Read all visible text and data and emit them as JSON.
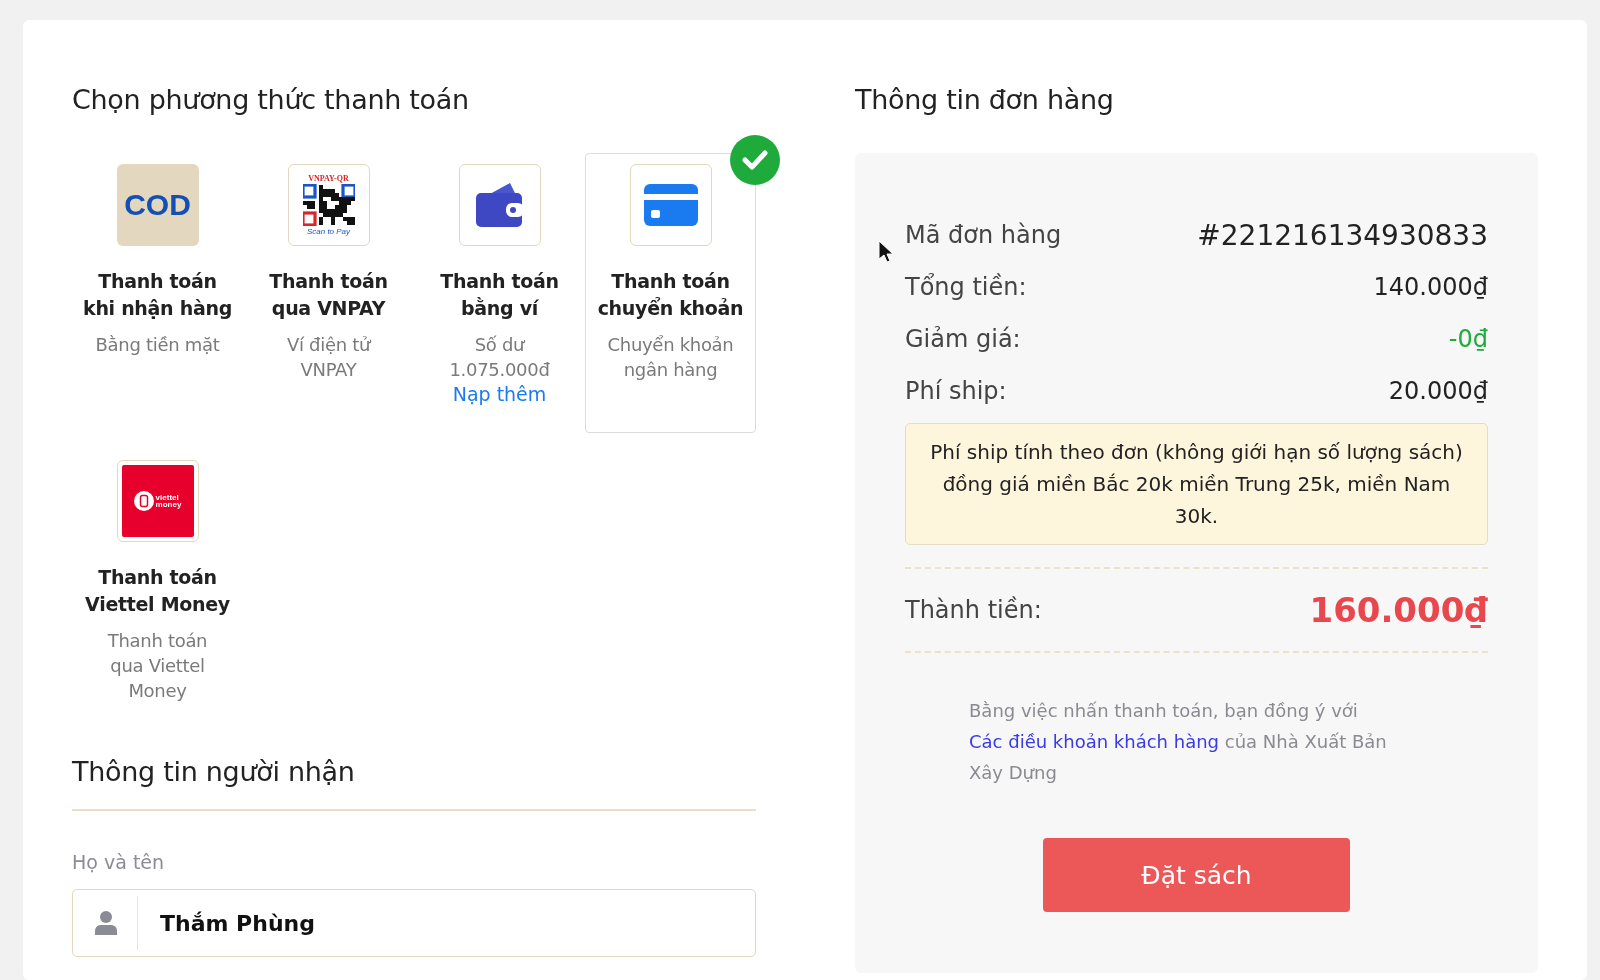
{
  "payment": {
    "title": "Chọn phương thức thanh toán",
    "methods": [
      {
        "kind": "cod",
        "logo": [
          "COD"
        ],
        "title": "Thanh toán\nkhi nhận hàng",
        "description": "Bằng tiền mặt",
        "selected": false
      },
      {
        "kind": "qr",
        "logo": [
          "VNPAY-QR",
          "Scan to Pay"
        ],
        "title": "Thanh toán\nqua VNPAY",
        "description": "Ví điện tử\nVNPAY",
        "selected": false
      },
      {
        "kind": "wallet",
        "title": "Thanh toán\nbằng ví",
        "description": "Số dư\n1.075.000đ",
        "link": "Nạp thêm",
        "selected": false
      },
      {
        "kind": "card",
        "title": "Thanh toán\nchuyển khoản",
        "description": "Chuyển khoản\nngân hàng",
        "selected": true
      },
      {
        "kind": "viettel",
        "logo": [
          "viettel",
          "money"
        ],
        "title": "Thanh toán\nViettel Money",
        "description": "Thanh toán\nqua Viettel\nMoney",
        "selected": false
      }
    ]
  },
  "recipient": {
    "title": "Thông tin người nhận",
    "fields": [
      {
        "label": "Họ và tên",
        "value": "Thắm Phùng"
      }
    ]
  },
  "order": {
    "title": "Thông tin đơn hàng",
    "rows": [
      {
        "kind": "code",
        "label": "Mã đơn hàng",
        "value": "#221216134930833"
      },
      {
        "kind": "plain",
        "label": "Tổng tiền:",
        "value": "140.000₫"
      },
      {
        "kind": "discount",
        "label": "Giảm giá:",
        "value": "-0₫"
      },
      {
        "kind": "plain",
        "label": "Phí ship:",
        "value": "20.000₫"
      }
    ],
    "note": "Phí ship tính theo đơn (không giới hạn số lượng sách) đồng giá miền Bắc 20k miền Trung 25k, miền Nam 30k.",
    "total": {
      "label": "Thành tiền:",
      "value": "160.000₫"
    },
    "terms": {
      "before": "Bằng việc nhấn thanh toán, bạn đồng ý với",
      "link": "Các điều khoản khách hàng",
      "after": "của Nhà Xuất Bản Xây Dựng"
    },
    "button": "Đặt sách"
  }
}
